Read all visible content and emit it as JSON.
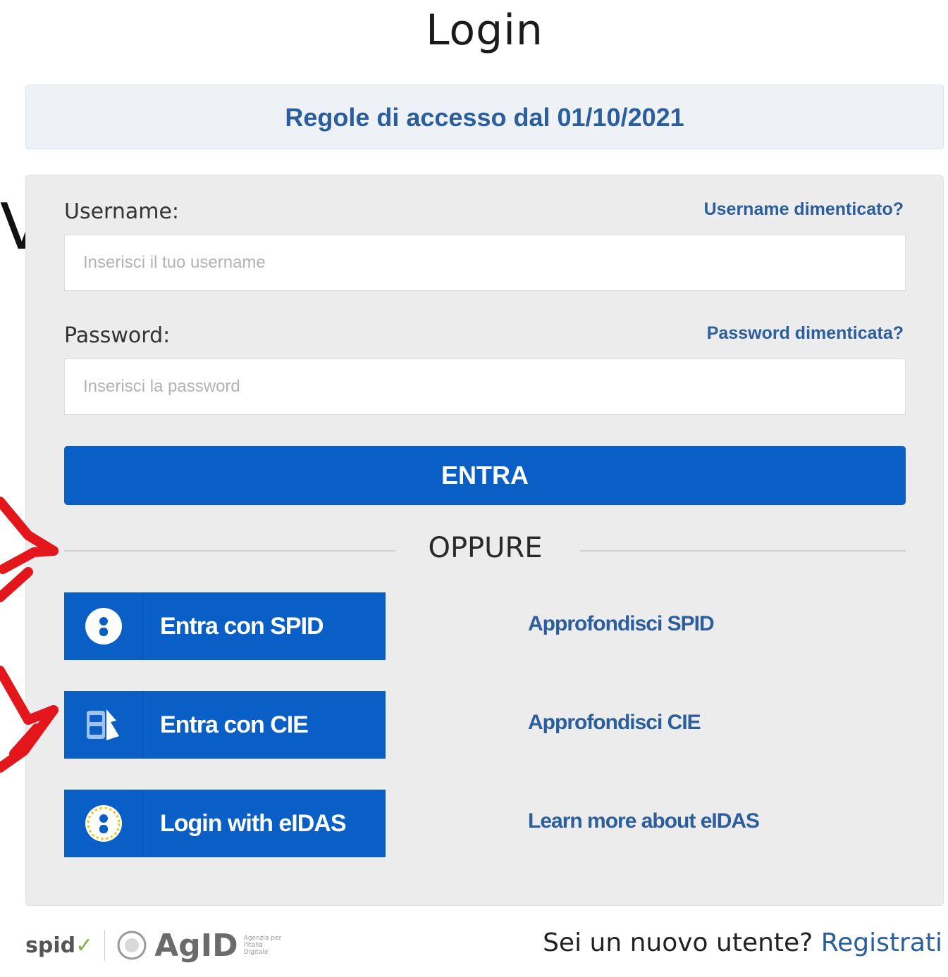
{
  "page_title": "Login",
  "banner": {
    "link_text": "Regole di accesso dal 01/10/2021"
  },
  "edge_text": "VI",
  "form": {
    "username_label": "Username:",
    "username_forgot": "Username dimenticato?",
    "username_placeholder": "Inserisci il tuo username",
    "password_label": "Password:",
    "password_forgot": "Password dimenticata?",
    "password_placeholder": "Inserisci la password",
    "submit_label": "ENTRA"
  },
  "divider_text": "OPPURE",
  "alt_logins": [
    {
      "label": "Entra con SPID",
      "icon": "spid-user-icon",
      "more": "Approfondisci SPID"
    },
    {
      "label": "Entra con CIE",
      "icon": "cie-card-icon",
      "more": "Approfondisci CIE"
    },
    {
      "label": "Login with eIDAS",
      "icon": "eidas-user-icon",
      "more": "Learn more about eIDAS"
    }
  ],
  "footer": {
    "spid_logo_text": "spid",
    "agid_logo_text": "AgID",
    "agid_logo_subtext": "Agenzia per l'Italia Digitale",
    "new_user_text": "Sei un nuovo utente?",
    "register_link": "Registrati"
  },
  "colors": {
    "primary_blue": "#0a5fc7",
    "link_blue": "#2b5e9d",
    "annotation_red": "#e3171b",
    "panel_bg": "#ececec"
  }
}
